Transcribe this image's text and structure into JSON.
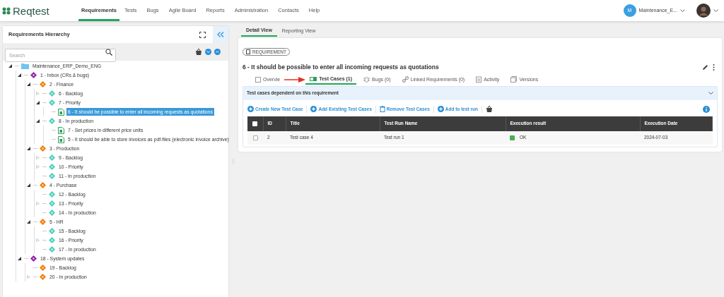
{
  "brand": "Reqtest",
  "nav": [
    {
      "label": "Requirements",
      "selected": true
    },
    {
      "label": "Tests",
      "selected": false
    },
    {
      "label": "Bugs",
      "selected": false
    },
    {
      "label": "Agile Board",
      "selected": false
    },
    {
      "label": "Reports",
      "selected": false
    },
    {
      "label": "Administration",
      "selected": false
    },
    {
      "label": "Contacts",
      "selected": false
    },
    {
      "label": "Help",
      "selected": false
    }
  ],
  "account": {
    "initial": "M",
    "name": "Maintenance_E..."
  },
  "sidebar": {
    "title": "Requirements Hierarchy",
    "search": {
      "placeholder": "Search"
    },
    "tree": [
      {
        "label": "Maintenance_ERP_Demo_ENG",
        "kind": "project",
        "expanded": true,
        "children": [
          {
            "label": "1 - Inbox (CRs & bugs)",
            "kind": "area",
            "expanded": true,
            "children": [
              {
                "label": "2 - Finance",
                "kind": "module",
                "expanded": true,
                "children": [
                  {
                    "label": "6 - Backlog",
                    "kind": "status",
                    "expanded": false
                  },
                  {
                    "label": "7 - Priority",
                    "kind": "status",
                    "expanded": true,
                    "children": [
                      {
                        "label": "6 - It should be possible to enter all incoming requests as quotations",
                        "kind": "requirement",
                        "selected": true
                      }
                    ]
                  },
                  {
                    "label": "8 - In production",
                    "kind": "status",
                    "expanded": true,
                    "children": [
                      {
                        "label": "7 - Set prices in different price units",
                        "kind": "requirement",
                        "selected": false
                      },
                      {
                        "label": "5 - It should be able to store invoices as pdf-files (electronic invoice archive)",
                        "kind": "requirement",
                        "selected": false
                      }
                    ]
                  }
                ]
              },
              {
                "label": "3 - Production",
                "kind": "module",
                "expanded": true,
                "children": [
                  {
                    "label": "9 - Backlog",
                    "kind": "status",
                    "expanded": false
                  },
                  {
                    "label": "10 - Priority",
                    "kind": "status",
                    "expanded": false
                  },
                  {
                    "label": "11 - In production",
                    "kind": "status"
                  }
                ]
              },
              {
                "label": "4 - Purchase",
                "kind": "module",
                "expanded": true,
                "children": [
                  {
                    "label": "12 - Backlog",
                    "kind": "status"
                  },
                  {
                    "label": "13 - Priority",
                    "kind": "status",
                    "expanded": false
                  },
                  {
                    "label": "14 - In production",
                    "kind": "status"
                  }
                ]
              },
              {
                "label": "5 - HR",
                "kind": "module",
                "expanded": true,
                "children": [
                  {
                    "label": "15 - Backlog",
                    "kind": "status"
                  },
                  {
                    "label": "16 - Priority",
                    "kind": "status",
                    "expanded": false
                  },
                  {
                    "label": "17 - In production",
                    "kind": "status"
                  }
                ]
              }
            ]
          },
          {
            "label": "18 - System updates",
            "kind": "area",
            "expanded": true,
            "children": [
              {
                "label": "19 - Backlog",
                "kind": "module"
              },
              {
                "label": "20 - In production",
                "kind": "module",
                "expanded": false
              }
            ]
          }
        ]
      }
    ]
  },
  "view_tabs": [
    {
      "label": "Detail View",
      "selected": true
    },
    {
      "label": "Reporting View",
      "selected": false
    }
  ],
  "badge": "REQUIREMENT",
  "title": "6 - It should be possible to enter all incoming requests as quotations",
  "detail_tabs": [
    {
      "label": "Overvie",
      "kind": "overview",
      "selected": false
    },
    {
      "label": "Test Cases (1)",
      "kind": "tests",
      "selected": true
    },
    {
      "label": "Bugs (0)",
      "kind": "bugs",
      "selected": false
    },
    {
      "label": "Linked Requirements (0)",
      "kind": "links",
      "selected": false
    },
    {
      "label": "Activity",
      "kind": "activity",
      "selected": false
    },
    {
      "label": "Versions",
      "kind": "versions",
      "selected": false
    }
  ],
  "section": {
    "title": "Test cases dependent on this requirement",
    "actions": [
      {
        "label": "Create New Test Case",
        "kind": "add"
      },
      {
        "label": "Add Existing Test Cases",
        "kind": "add"
      },
      {
        "label": "Remove Test Cases",
        "kind": "remove"
      },
      {
        "label": "Add to test run",
        "kind": "add"
      }
    ],
    "table": {
      "all_checked": false,
      "columns": [
        "ID",
        "Title",
        "Test Run Name",
        "Execution result",
        "Execution Date"
      ],
      "rows": [
        {
          "checked": false,
          "id": "2",
          "title": "Test case 4",
          "run": "Test run 1",
          "result": "OK",
          "color": "#4caf50",
          "date": "2024-07-03"
        }
      ]
    }
  }
}
